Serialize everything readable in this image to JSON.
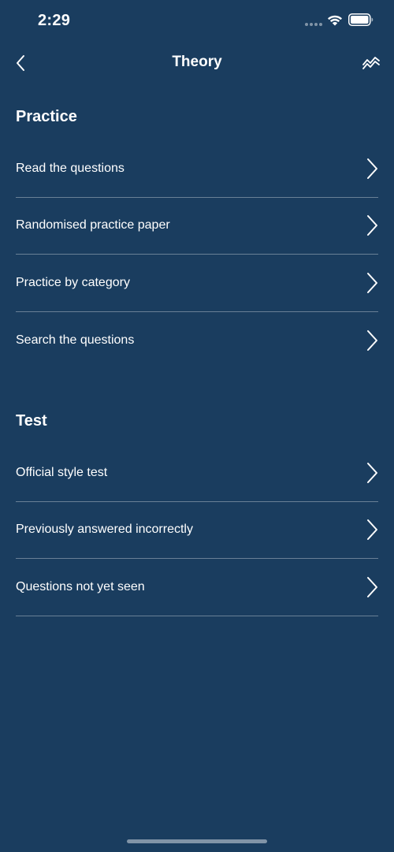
{
  "status_bar": {
    "time": "2:29"
  },
  "nav": {
    "title": "Theory",
    "back_icon": "chevron-left-icon",
    "action_icon": "stats-chart-icon"
  },
  "practice": {
    "title": "Practice",
    "items": [
      {
        "label": "Read the questions"
      },
      {
        "label": "Randomised practice paper"
      },
      {
        "label": "Practice by category"
      },
      {
        "label": "Search the questions"
      }
    ]
  },
  "test": {
    "title": "Test",
    "items": [
      {
        "label": "Official style test"
      },
      {
        "label": "Previously answered incorrectly"
      },
      {
        "label": "Questions not yet seen"
      }
    ]
  },
  "colors": {
    "background": "#1a3d5f",
    "text": "#ffffff",
    "divider": "rgba(255,255,255,0.35)"
  }
}
